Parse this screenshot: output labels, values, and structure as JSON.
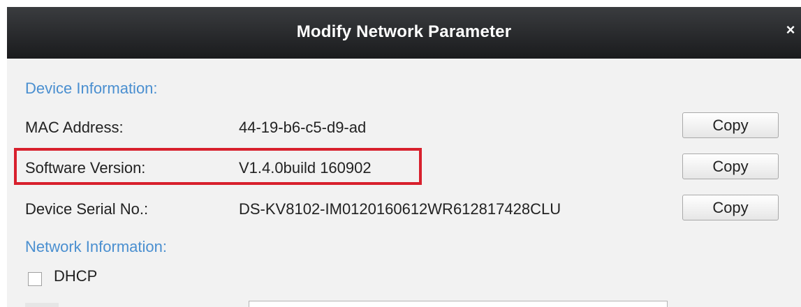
{
  "dialog": {
    "title": "Modify Network Parameter",
    "close_glyph": "×"
  },
  "device_info": {
    "section_title": "Device Information:",
    "rows": [
      {
        "label": "MAC Address:",
        "value": "44-19-b6-c5-d9-ad",
        "button": "Copy"
      },
      {
        "label": "Software Version:",
        "value": "V1.4.0build 160902",
        "button": "Copy"
      },
      {
        "label": "Device Serial No.:",
        "value": "DS-KV8102-IM0120160612WR612817428CLU",
        "button": "Copy"
      }
    ]
  },
  "network_info": {
    "section_title": "Network Information:",
    "dhcp_label": "DHCP",
    "dhcp_checked": false
  },
  "colors": {
    "section_title": "#4a8fd0",
    "highlight_border": "#d8202d",
    "titlebar": "#2a2b2e"
  }
}
